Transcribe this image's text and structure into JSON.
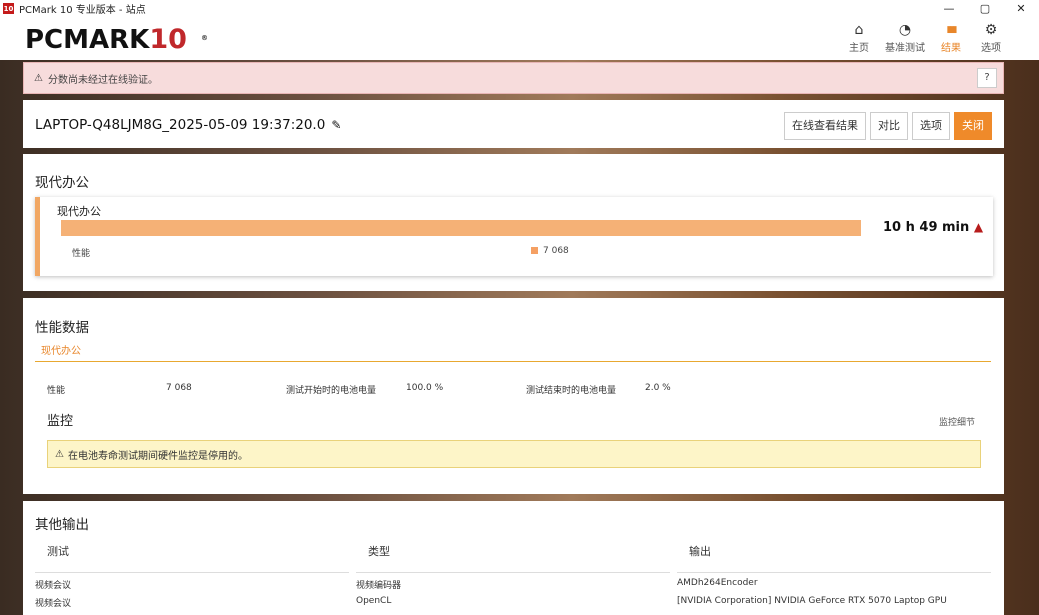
{
  "window": {
    "title": "PCMark 10 专业版本 - 站点",
    "app_icon": "10",
    "controls": [
      "—",
      "▢",
      "✕"
    ]
  },
  "app": {
    "logo_main": "PCMARK",
    "logo_num": "10",
    "logo_reg": "®"
  },
  "nav": [
    {
      "label": "主页",
      "icon": "home-icon",
      "glyph": "⌂"
    },
    {
      "label": "基准测试",
      "icon": "gauge-icon",
      "glyph": "◔"
    },
    {
      "label": "结果",
      "icon": "bar-chart-icon",
      "glyph": "▮▮▮"
    },
    {
      "label": "选项",
      "icon": "gear-icon",
      "glyph": "⚙"
    }
  ],
  "banner": {
    "text": "分数尚未经过在线验证。",
    "help": "?"
  },
  "run": {
    "name": "LAPTOP-Q48LJM8G_2025-05-09 19:37:20.0",
    "buttons": {
      "online": "在线查看结果",
      "compare": "对比",
      "options": "选项",
      "close": "关闭"
    }
  },
  "modern_office": {
    "title": "现代办公",
    "box_label": "现代办公",
    "duration": "10 h 49 min",
    "perf_label": "性能",
    "legend_value": "7 068",
    "bar_fraction": 1.0
  },
  "perf_data": {
    "title": "性能数据",
    "tab": "现代办公",
    "rows": [
      {
        "label": "性能",
        "value": "7 068"
      },
      {
        "label": "测试开始时的电池电量",
        "value": "100.0 %"
      },
      {
        "label": "测试结束时的电池电量",
        "value": "2.0 %"
      }
    ],
    "monitor_title": "监控",
    "monitor_link": "监控细节",
    "monitor_warning": "在电池寿命测试期间硬件监控是停用的。"
  },
  "other_output": {
    "title": "其他输出",
    "headers": [
      "测试",
      "类型",
      "输出"
    ],
    "rows": [
      [
        "视频会议",
        "视频编码器",
        "AMDh264Encoder"
      ],
      [
        "视频会议",
        "OpenCL",
        "[NVIDIA Corporation] NVIDIA GeForce RTX 5070 Laptop GPU"
      ]
    ]
  }
}
